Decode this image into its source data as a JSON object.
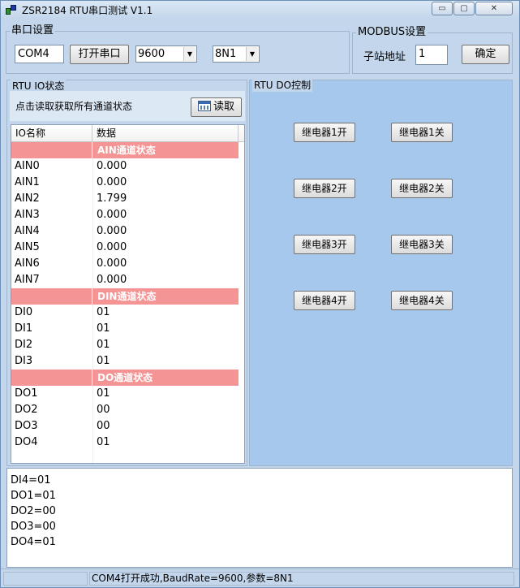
{
  "window": {
    "title": "ZSR2184 RTU串口测试 V1.1",
    "controls": {
      "minimize": "▭",
      "maximize": "▢",
      "close": "✕"
    }
  },
  "serial": {
    "group_title": "串口设置",
    "port_value": "COM4",
    "open_button": "打开串口",
    "baud_value": "9600",
    "params_value": "8N1"
  },
  "modbus": {
    "group_title": "MODBUS设置",
    "slave_label": "子站地址",
    "slave_value": "1",
    "confirm_button": "确定"
  },
  "io": {
    "group_title": "RTU IO状态",
    "hint": "点击读取获取所有通道状态",
    "read_button": "读取",
    "columns": [
      "IO名称",
      "数据"
    ],
    "sections": [
      {
        "title": "AIN通道状态",
        "rows": [
          {
            "name": "AIN0",
            "value": "0.000"
          },
          {
            "name": "AIN1",
            "value": "0.000"
          },
          {
            "name": "AIN2",
            "value": "1.799"
          },
          {
            "name": "AIN3",
            "value": "0.000"
          },
          {
            "name": "AIN4",
            "value": "0.000"
          },
          {
            "name": "AIN5",
            "value": "0.000"
          },
          {
            "name": "AIN6",
            "value": "0.000"
          },
          {
            "name": "AIN7",
            "value": "0.000"
          }
        ]
      },
      {
        "title": "DIN通道状态",
        "rows": [
          {
            "name": "DI0",
            "value": "01"
          },
          {
            "name": "DI1",
            "value": "01"
          },
          {
            "name": "DI2",
            "value": "01"
          },
          {
            "name": "DI3",
            "value": "01"
          }
        ]
      },
      {
        "title": "DO通道状态",
        "rows": [
          {
            "name": "DO1",
            "value": "01"
          },
          {
            "name": "DO2",
            "value": "00"
          },
          {
            "name": "DO3",
            "value": "00"
          },
          {
            "name": "DO4",
            "value": "01"
          }
        ]
      }
    ]
  },
  "do_control": {
    "group_title": "RTU DO控制",
    "relays": [
      {
        "on": "继电器1开",
        "off": "继电器1关"
      },
      {
        "on": "继电器2开",
        "off": "继电器2关"
      },
      {
        "on": "继电器3开",
        "off": "继电器3关"
      },
      {
        "on": "继电器4开",
        "off": "继电器4关"
      }
    ]
  },
  "log": {
    "lines": [
      "DI4=01",
      "DO1=01",
      "DO2=00",
      "DO3=00",
      "DO4=01"
    ]
  },
  "status": {
    "message": "COM4打开成功,BaudRate=9600,参数=8N1"
  },
  "colors": {
    "section_header": "#f49494",
    "do_panel_bg": "#a6c8ec",
    "window_bg": "#c3d6eb"
  }
}
